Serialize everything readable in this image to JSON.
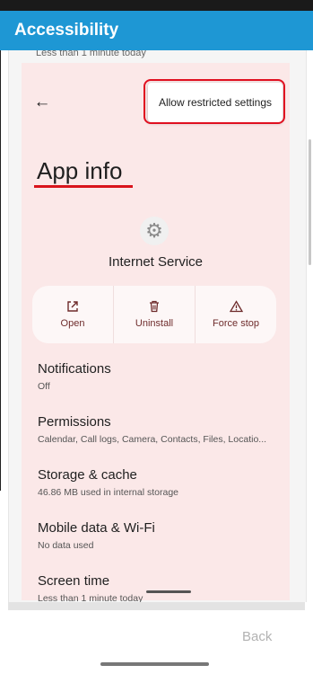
{
  "appbar": {
    "title": "Accessibility"
  },
  "peek_text": "Less than 1 minute today",
  "menu": {
    "label": "Allow restricted settings"
  },
  "page": {
    "title": "App info"
  },
  "app": {
    "name": "Internet Service"
  },
  "actions": [
    {
      "label": "Open",
      "icon": "open-external-icon"
    },
    {
      "label": "Uninstall",
      "icon": "trash-icon"
    },
    {
      "label": "Force stop",
      "icon": "warning-icon"
    }
  ],
  "items": [
    {
      "title": "Notifications",
      "subtitle": "Off"
    },
    {
      "title": "Permissions",
      "subtitle": "Calendar, Call logs, Camera, Contacts, Files, Locatio..."
    },
    {
      "title": "Storage & cache",
      "subtitle": "46.86 MB used in internal storage"
    },
    {
      "title": "Mobile data & Wi-Fi",
      "subtitle": "No data used"
    },
    {
      "title": "Screen time",
      "subtitle": "Less than 1 minute today"
    }
  ],
  "footer": {
    "back_label": "Back"
  },
  "colors": {
    "appbar": "#1e97d4",
    "card": "#fbe8e8",
    "highlight": "#e01020",
    "action_text": "#6e2b2b"
  }
}
